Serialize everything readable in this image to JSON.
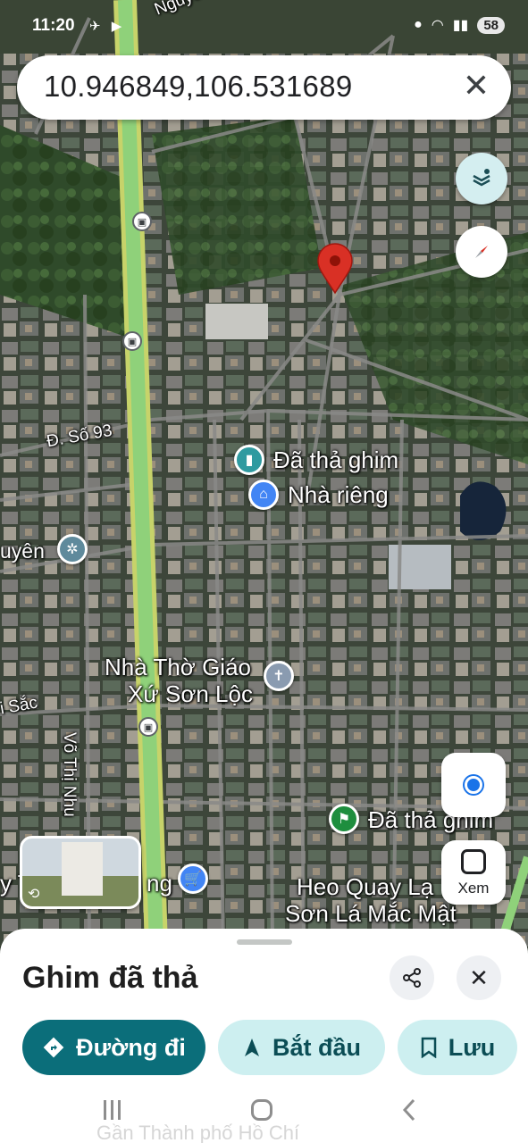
{
  "status_bar": {
    "time": "11:20",
    "battery": "58"
  },
  "search": {
    "query": "10.946849,106.531689"
  },
  "map": {
    "labels": {
      "street_nguyen": "Nguyễn",
      "duong_so_93": "Đ. Số 93",
      "uyen": "uyên",
      "i_sac": "i Sắc",
      "vo_thi_nhu": "Võ Thị Nhu",
      "pin_label": "Đã thả ghim",
      "nha_rieng": "Nhà riêng",
      "church_line1": "Nhà Thờ Giáo",
      "church_line2": "Xứ Sơn Lộc",
      "pin_label_2": "Đã thả ghim",
      "heo_line1": "Heo Quay Lạ",
      "heo_line2": "Sơn Lá Mắc Mật",
      "y_t": "y T",
      "ng": "ng"
    },
    "xem_label": "Xem"
  },
  "sheet": {
    "title": "Ghim đã thả",
    "actions": [
      {
        "label": "Đường đi",
        "icon": "directions-icon"
      },
      {
        "label": "Bắt đầu",
        "icon": "navigation-arrow-icon"
      },
      {
        "label": "Lưu",
        "icon": "bookmark-icon"
      }
    ],
    "peek_text": "Gần Thành phố Hồ Chí"
  },
  "colors": {
    "primary": "#0b6e7a",
    "secondary": "#cdeff0",
    "pin": "#d93025",
    "road": "#8fd17a"
  }
}
